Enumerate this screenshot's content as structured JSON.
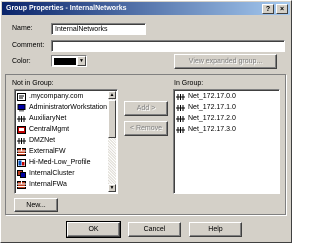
{
  "window": {
    "title": "Group Properties - InternalNetworks",
    "help_glyph": "?",
    "close_glyph": "×"
  },
  "form": {
    "name_label": "Name:",
    "name_value": "InternalNetworks",
    "comment_label": "Comment:",
    "comment_value": "",
    "color_label": "Color:",
    "color_value": "#000000",
    "view_expanded_label": "View expanded group..."
  },
  "not_in_group": {
    "label": "Not in Group:",
    "items": [
      {
        "name": ".mycompany.com",
        "icon": "domain-icon"
      },
      {
        "name": "AdministratorWorkstation",
        "icon": "workstation-icon"
      },
      {
        "name": "AuxiliaryNet",
        "icon": "network-icon"
      },
      {
        "name": "CentralMgmt",
        "icon": "management-icon"
      },
      {
        "name": "DMZNet",
        "icon": "network-icon"
      },
      {
        "name": "ExternalFW",
        "icon": "firewall-icon"
      },
      {
        "name": "Hi-Med-Low_Profile",
        "icon": "profile-icon"
      },
      {
        "name": "InternalCluster",
        "icon": "cluster-icon"
      },
      {
        "name": "InternalFWa",
        "icon": "firewall-icon"
      }
    ]
  },
  "in_group": {
    "label": "In Group:",
    "items": [
      {
        "name": "Net_172.17.0.0",
        "icon": "network-icon"
      },
      {
        "name": "Net_172.17.1.0",
        "icon": "network-icon"
      },
      {
        "name": "Net_172.17.2.0",
        "icon": "network-icon"
      },
      {
        "name": "Net_172.17.3.0",
        "icon": "network-icon"
      }
    ]
  },
  "buttons": {
    "add": "Add  >",
    "remove": "<  Remove",
    "new": "New...",
    "ok": "OK",
    "cancel": "Cancel",
    "help": "Help"
  }
}
